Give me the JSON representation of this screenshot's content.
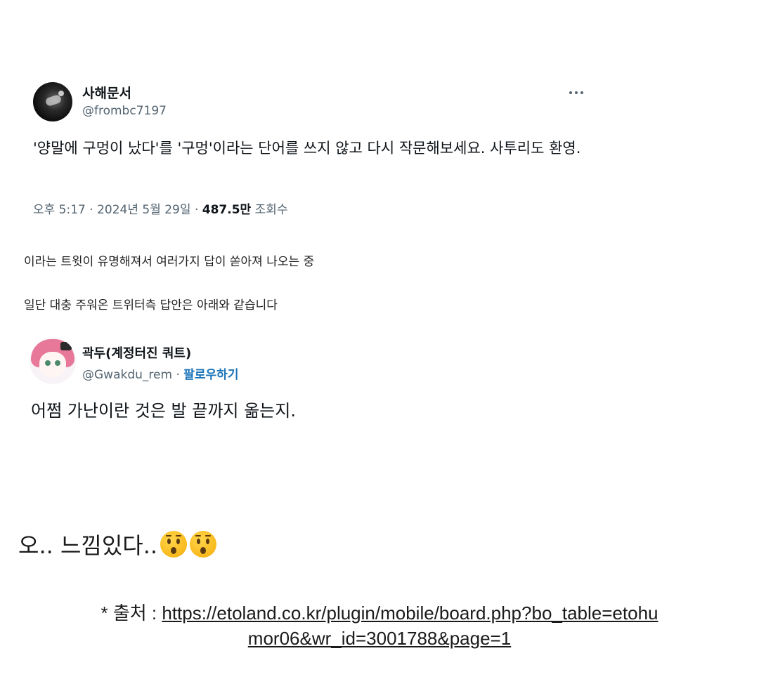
{
  "tweet1": {
    "name": "사해문서",
    "handle": "@frombc7197",
    "more_icon": "more-horizontal-icon",
    "body": "'양말에 구멍이 났다'를 '구멍'이라는 단어를 쓰지 않고 다시 작문해보세요. 사투리도 환영.",
    "time": "오후 5:17",
    "date": "2024년 5월 29일",
    "views_count": "487.5만",
    "views_label": "조회수"
  },
  "captions": {
    "line1": "이라는 트윗이 유명해져서 여러가지 답이 쏟아져 나오는 중",
    "line2": "일단 대충 주워온 트위터측 답안은 아래와 같습니다"
  },
  "tweet2": {
    "name": "곽두(계정터진 쿼트)",
    "handle": "@Gwakdu_rem",
    "follow_label": "팔로우하기",
    "body": "어쩜 가난이란 것은 발 끝까지 옮는지."
  },
  "reaction": {
    "text": "오.. 느낌있다..",
    "emoji": "hushed-face-icon"
  },
  "source": {
    "prefix": "* 출처 : ",
    "url": "https://etoland.co.kr/plugin/mobile/board.php?bo_table=etohumor06&wr_id=3001788&page=1",
    "url_line1": "https://etoland.co.kr/plugin/mobile/board.php?bo_table=etohu",
    "url_line2": "mor06&wr_id=3001788&page=1"
  },
  "colors": {
    "text_primary": "#0f1419",
    "text_secondary": "#536471",
    "follow_link": "#1a73b8"
  }
}
